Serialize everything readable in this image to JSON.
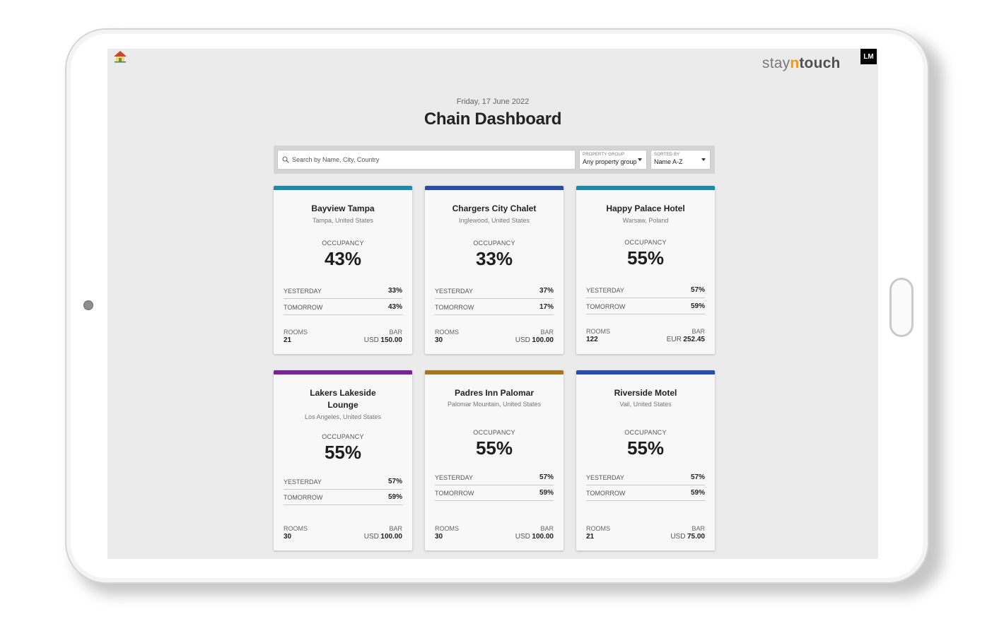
{
  "header": {
    "brand_prefix": "stay",
    "brand_n": "n",
    "brand_suffix": "touch",
    "user_initials": "LM",
    "date": "Friday, 17 June 2022",
    "title": "Chain Dashboard"
  },
  "filters": {
    "search_placeholder": "Search by Name, City, Country",
    "property_group_label": "PROPERTY GROUP",
    "property_group_value": "Any property group",
    "sorted_by_label": "SORTED BY",
    "sorted_by_value": "Name A-Z"
  },
  "labels": {
    "occupancy": "OCCUPANCY",
    "yesterday": "YESTERDAY",
    "tomorrow": "TOMORROW",
    "rooms": "ROOMS",
    "bar": "BAR"
  },
  "properties": [
    {
      "name": "Bayview Tampa",
      "location": "Tampa, United States",
      "occupancy": "43%",
      "yesterday": "33%",
      "tomorrow": "43%",
      "rooms": "21",
      "bar_currency": "USD",
      "bar_value": "150.00",
      "accent": "#1f8aa8"
    },
    {
      "name": "Chargers City Chalet",
      "location": "Inglewood, United States",
      "occupancy": "33%",
      "yesterday": "37%",
      "tomorrow": "17%",
      "rooms": "30",
      "bar_currency": "USD",
      "bar_value": "100.00",
      "accent": "#2a4ea8"
    },
    {
      "name": "Happy Palace Hotel",
      "location": "Warsaw, Poland",
      "occupancy": "55%",
      "yesterday": "57%",
      "tomorrow": "59%",
      "rooms": "122",
      "bar_currency": "EUR",
      "bar_value": "252.45",
      "accent": "#1f8aa8"
    },
    {
      "name": "Lakers Lakeside Lounge",
      "location": "Los Angeles, United States",
      "occupancy": "55%",
      "yesterday": "57%",
      "tomorrow": "59%",
      "rooms": "30",
      "bar_currency": "USD",
      "bar_value": "100.00",
      "accent": "#7b2396"
    },
    {
      "name": "Padres Inn Palomar",
      "location": "Palomar Mountain, United States",
      "occupancy": "55%",
      "yesterday": "57%",
      "tomorrow": "59%",
      "rooms": "30",
      "bar_currency": "USD",
      "bar_value": "100.00",
      "accent": "#a8761f"
    },
    {
      "name": "Riverside Motel",
      "location": "Vail, United States",
      "occupancy": "55%",
      "yesterday": "57%",
      "tomorrow": "59%",
      "rooms": "21",
      "bar_currency": "USD",
      "bar_value": "75.00",
      "accent": "#2a4ea8"
    }
  ]
}
